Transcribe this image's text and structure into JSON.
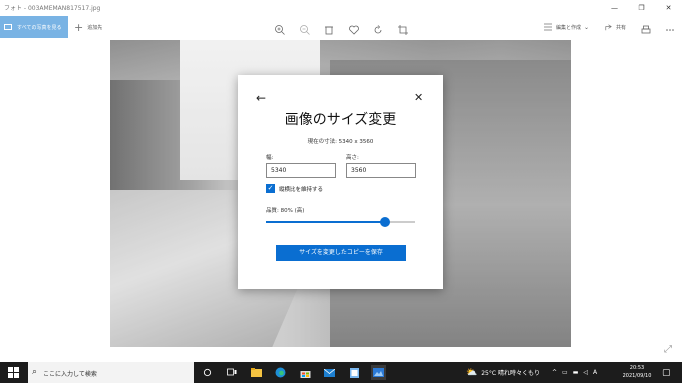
{
  "window": {
    "title": "フォト - 003AMEMAN817517.jpg",
    "minimize_glyph": "—",
    "maximize_glyph": "❐",
    "close_glyph": "✕"
  },
  "toolbar": {
    "all_photos_label": "すべての写真を見る",
    "add_label": "追加先",
    "edit_label": "編集と作成",
    "share_label": "共有",
    "icons": [
      "zoom-in-icon",
      "zoom-out-icon",
      "delete-icon",
      "heart-icon",
      "rotate-icon",
      "crop-icon",
      "print-icon",
      "more-icon"
    ]
  },
  "dialog": {
    "back_glyph": "←",
    "close_glyph": "✕",
    "title": "画像のサイズ変更",
    "current_size": "現在の寸法: 5340 x 3560",
    "width_label": "幅:",
    "width_value": "5340",
    "height_label": "高さ:",
    "height_value": "3560",
    "keep_ratio_label": "縦横比を維持する",
    "keep_ratio_checked": true,
    "quality_label": "品質: 80% (高)",
    "quality_value": 80,
    "save_button": "サイズを変更したコピーを保存"
  },
  "taskbar": {
    "search_placeholder": "ここに入力して検索",
    "weather": "25°C 晴れ時々くもり",
    "ime": "A",
    "time": "20:53",
    "date": "2021/09/10",
    "apps": [
      "cortana-icon",
      "task-view-icon",
      "file-explorer-icon",
      "edge-icon",
      "store-icon",
      "mail-icon",
      "notepad-icon",
      "photos-icon"
    ]
  },
  "colors": {
    "accent": "#0a6ed1",
    "all_photos_bg": "#79b3e4",
    "taskbar_bg": "#1c1c1c"
  }
}
